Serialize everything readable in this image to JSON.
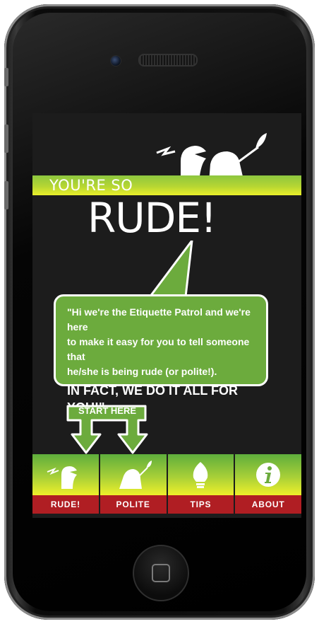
{
  "app": {
    "headline_small": "YOU'RE SO",
    "headline_big": "RUDE!"
  },
  "intro": {
    "line1": "\"Hi we're the Etiquette Patrol and we're here",
    "line2": "to make it easy for you to tell someone that",
    "line3": "he/she is being rude (or polite!).",
    "shout": "IN FACT, WE DO IT ALL FOR YOU!\""
  },
  "start_here": {
    "label": "START HERE"
  },
  "tabs": [
    {
      "label": "RUDE!",
      "icon": "rude-bird-icon"
    },
    {
      "label": "POLITE",
      "icon": "polite-bird-icon"
    },
    {
      "label": "TIPS",
      "icon": "lightbulb-icon"
    },
    {
      "label": "ABOUT",
      "icon": "info-icon"
    }
  ],
  "colors": {
    "green": "#6cab3d",
    "yellow": "#eef02a",
    "red": "#b01e23",
    "background": "#1c1c1c"
  }
}
